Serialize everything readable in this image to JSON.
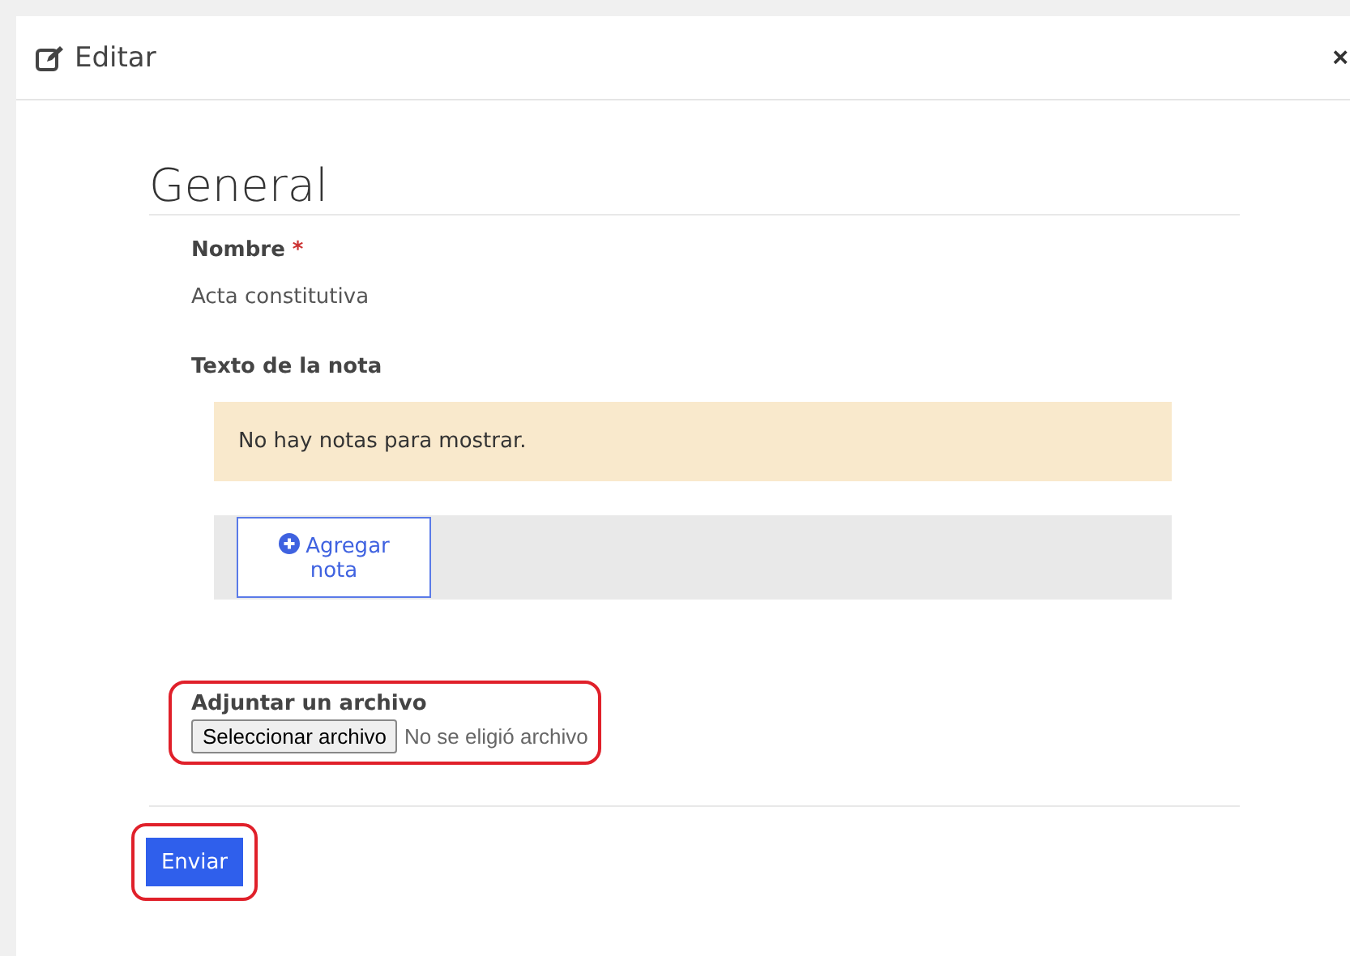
{
  "dialog": {
    "title": "Editar",
    "close": "×"
  },
  "section": {
    "title": "General"
  },
  "fields": [
    {
      "kind": "text",
      "label": "Nombre",
      "required_mark": "*",
      "value": "Acta constitutiva"
    },
    {
      "kind": "notes",
      "label": "Texto de la nota",
      "empty_message": "No hay notas para mostrar.",
      "add_button": "Agregar nota"
    },
    {
      "kind": "file",
      "label": "Adjuntar un archivo",
      "button": "Seleccionar archivo",
      "status": "No se eligió archivo",
      "highlighted": true
    }
  ],
  "submit": {
    "label": "Enviar",
    "highlighted": true
  }
}
